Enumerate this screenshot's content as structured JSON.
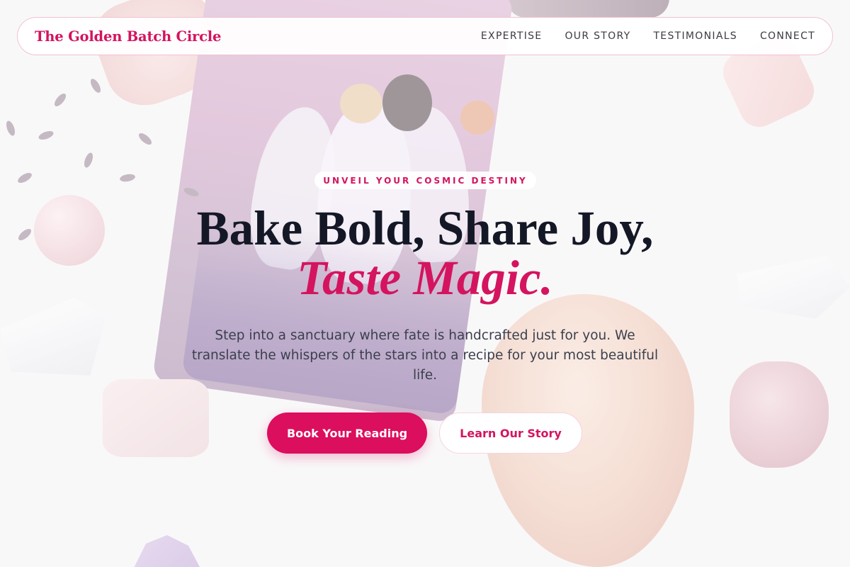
{
  "brand": {
    "name": "The Golden Batch Circle"
  },
  "nav": {
    "items": [
      {
        "label": "EXPERTISE"
      },
      {
        "label": "OUR STORY"
      },
      {
        "label": "TESTIMONIALS"
      },
      {
        "label": "CONNECT"
      }
    ]
  },
  "hero": {
    "eyebrow": "UNVEIL YOUR COSMIC DESTINY",
    "headline_line1": "Bake Bold, Share Joy,",
    "headline_line2": "Taste Magic.",
    "subtitle": "Step into a sanctuary where fate is handcrafted just for you. We translate the whispers of the stars into a recipe for your most beautiful life.",
    "primary_cta": "Book Your Reading",
    "secondary_cta": "Learn Our Story"
  },
  "colors": {
    "accent": "#d4145f",
    "primary_button": "#dc0e5e",
    "headline": "#141826",
    "body_text": "#3b3f4d"
  }
}
